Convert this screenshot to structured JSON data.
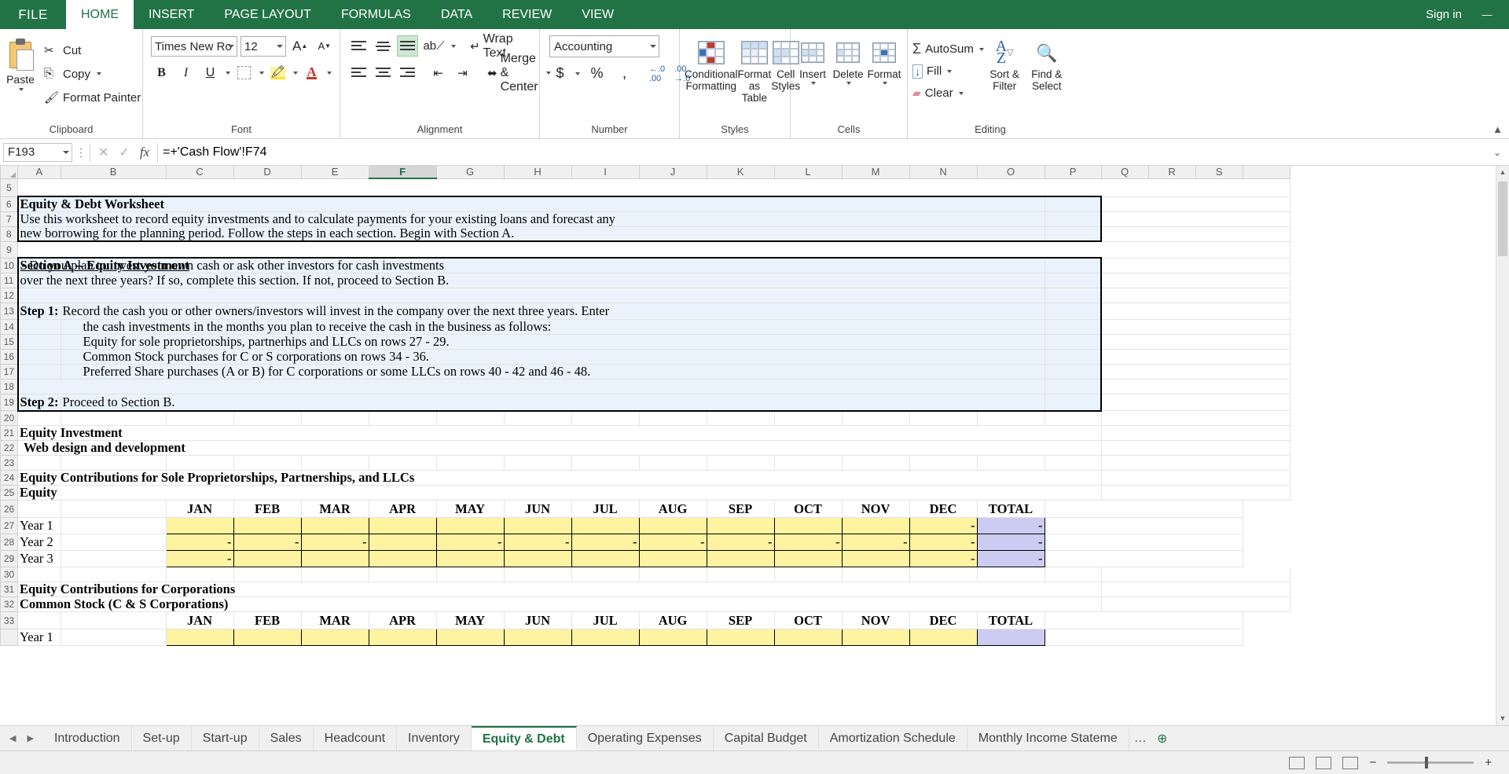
{
  "app": {
    "signin": "Sign in",
    "window_controls": [
      "—",
      "❐",
      "✕"
    ]
  },
  "ribbon_tabs": [
    {
      "label": "FILE",
      "active": false,
      "file": true
    },
    {
      "label": "HOME",
      "active": true
    },
    {
      "label": "INSERT",
      "active": false
    },
    {
      "label": "PAGE LAYOUT",
      "active": false
    },
    {
      "label": "FORMULAS",
      "active": false
    },
    {
      "label": "DATA",
      "active": false
    },
    {
      "label": "REVIEW",
      "active": false
    },
    {
      "label": "VIEW",
      "active": false
    }
  ],
  "ribbon": {
    "clipboard": {
      "label": "Clipboard",
      "paste": "Paste",
      "cut": "Cut",
      "copy": "Copy",
      "format_painter": "Format Painter"
    },
    "font": {
      "label": "Font",
      "font_name": "Times New Ro",
      "font_size": "12",
      "grow_font": "A",
      "shrink_font": "A",
      "bold": "B",
      "italic": "I",
      "underline": "U",
      "borders": "Borders",
      "fill_color": "A",
      "font_color": "A"
    },
    "alignment": {
      "label": "Alignment",
      "wrap_text": "Wrap Text",
      "merge_center": "Merge & Center",
      "orientation": "Orientation",
      "decrease_indent": "Decrease Indent",
      "increase_indent": "Increase Indent"
    },
    "number": {
      "label": "Number",
      "format": "Accounting",
      "currency": "$",
      "percent": "%",
      "comma": ",",
      "decrease_decimal": ".00",
      "increase_decimal": ".00"
    },
    "styles": {
      "label": "Styles",
      "conditional_formatting": "Conditional\nFormatting",
      "conditional_formatting_l1": "Conditional",
      "conditional_formatting_l2": "Formatting",
      "format_as_table_l1": "Format as",
      "format_as_table_l2": "Table",
      "cell_styles_l1": "Cell",
      "cell_styles_l2": "Styles"
    },
    "cells": {
      "label": "Cells",
      "insert": "Insert",
      "delete": "Delete",
      "format": "Format"
    },
    "editing": {
      "label": "Editing",
      "autosum": "AutoSum",
      "fill": "Fill",
      "clear": "Clear",
      "sort_filter_l1": "Sort &",
      "sort_filter_l2": "Filter",
      "find_select_l1": "Find &",
      "find_select_l2": "Select"
    }
  },
  "formula_bar": {
    "name_box": "F193",
    "cancel": "✕",
    "enter": "✓",
    "fx": "fx",
    "formula": "=+'Cash Flow'!F74"
  },
  "grid": {
    "columns": [
      "A",
      "B",
      "C",
      "D",
      "E",
      "F",
      "G",
      "H",
      "I",
      "J",
      "K",
      "L",
      "M",
      "N",
      "O",
      "P",
      "Q",
      "R",
      "S"
    ],
    "selected_column": "F",
    "rows": [
      5,
      6,
      7,
      8,
      9,
      10,
      11,
      12,
      13,
      14,
      15,
      16,
      17,
      18,
      19,
      20,
      21,
      22,
      23,
      24,
      25,
      26,
      27,
      28,
      29,
      30,
      31,
      32,
      33
    ],
    "content": {
      "r6_a": "Equity & Debt Worksheet",
      "r7_a": "Use this worksheet to record equity investments and to calculate payments for your existing loans and forecast any",
      "r8_a": "new borrowing for the planning period. Follow the steps in each section. Begin with Section A.",
      "r10_head": "Section A -- Equity Investment",
      "r10_tail": " - Do you plan to invest your own cash or ask other investors for cash investments",
      "r11_a": "over the next three years? If so, complete this section. If not, proceed to Section B.",
      "r13_step": "Step 1:",
      "r13_a": "Record the cash you or other owners/investors will invest in the company over the next three years.  Enter",
      "r14_a": "the cash investments in the months you plan to receive the cash in the business as follows:",
      "r15_a": "Equity for sole proprietorships, partnerhips and LLCs on rows 27 - 29.",
      "r16_a": "Common Stock purchases for C or S corporations on rows 34 - 36.",
      "r17_a": "Preferred Share purchases (A or B) for C corporations or some LLCs on rows 40 - 42 and 46 - 48.",
      "r19_step": "Step 2:",
      "r19_a": "Proceed to Section B.",
      "r21_a": "Equity Investment",
      "r22_a": "Web design and development",
      "r24_a": "Equity Contributions for Sole Proprietorships, Partnerships, and LLCs",
      "r25_a": "Equity",
      "r31_a": "Equity Contributions for Corporations",
      "r32_a": "Common Stock (C & S Corporations)",
      "r33_a": "Year 1"
    },
    "month_headers": [
      "JAN",
      "FEB",
      "MAR",
      "APR",
      "MAY",
      "JUN",
      "JUL",
      "AUG",
      "SEP",
      "OCT",
      "NOV",
      "DEC"
    ],
    "total_header": "TOTAL",
    "table1": {
      "rows": [
        {
          "label": "Year 1",
          "values": [
            "",
            "",
            "",
            "",
            "",
            "",
            "",
            "",
            "",
            "",
            "",
            "-"
          ],
          "total": "-"
        },
        {
          "label": "Year 2",
          "values": [
            "-",
            "-",
            "-",
            "",
            "-",
            "-",
            "-",
            "-",
            "-",
            "-",
            "-",
            "-"
          ],
          "total": "-"
        },
        {
          "label": "Year 3",
          "values": [
            "-",
            "",
            "",
            "",
            "",
            "",
            "",
            "",
            "",
            "",
            "",
            "-"
          ],
          "total": "-"
        }
      ]
    }
  },
  "sheet_tabs": [
    {
      "label": "Introduction",
      "active": false
    },
    {
      "label": "Set-up",
      "active": false
    },
    {
      "label": "Start-up",
      "active": false
    },
    {
      "label": "Sales",
      "active": false
    },
    {
      "label": "Headcount",
      "active": false
    },
    {
      "label": "Inventory",
      "active": false
    },
    {
      "label": "Equity & Debt",
      "active": true
    },
    {
      "label": "Operating Expenses",
      "active": false
    },
    {
      "label": "Capital Budget",
      "active": false
    },
    {
      "label": "Amortization Schedule",
      "active": false
    },
    {
      "label": "Monthly Income Stateme",
      "active": false
    },
    {
      "label": "…",
      "active": false
    }
  ],
  "sheet_nav": {
    "prev": "◀",
    "next": "▶",
    "add": "⊕"
  },
  "status_bar": {
    "ready": "",
    "zoom": ""
  }
}
